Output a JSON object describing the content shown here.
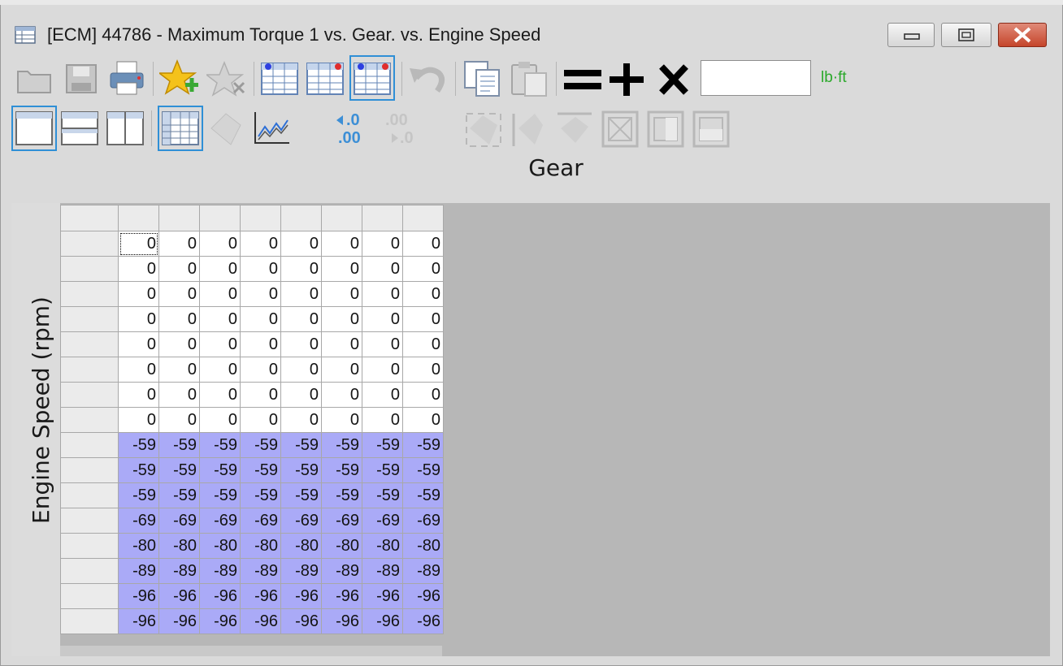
{
  "window": {
    "title": "[ECM] 44786 - Maximum Torque 1 vs. Gear. vs. Engine Speed"
  },
  "toolbar": {
    "value_input": "",
    "unit": "lb·ft"
  },
  "axes": {
    "x_title": "Gear",
    "y_title": "Engine Speed (rpm)"
  },
  "table": {
    "column_headers": [
      "",
      "",
      "",
      "",
      "",
      "",
      "",
      ""
    ],
    "row_headers": [
      "",
      "",
      "",
      "",
      "",
      "",
      "",
      "",
      "",
      "",
      "",
      "",
      "",
      "",
      "",
      ""
    ],
    "rows": [
      [
        "0",
        "0",
        "0",
        "0",
        "0",
        "0",
        "0",
        "0"
      ],
      [
        "0",
        "0",
        "0",
        "0",
        "0",
        "0",
        "0",
        "0"
      ],
      [
        "0",
        "0",
        "0",
        "0",
        "0",
        "0",
        "0",
        "0"
      ],
      [
        "0",
        "0",
        "0",
        "0",
        "0",
        "0",
        "0",
        "0"
      ],
      [
        "0",
        "0",
        "0",
        "0",
        "0",
        "0",
        "0",
        "0"
      ],
      [
        "0",
        "0",
        "0",
        "0",
        "0",
        "0",
        "0",
        "0"
      ],
      [
        "0",
        "0",
        "0",
        "0",
        "0",
        "0",
        "0",
        "0"
      ],
      [
        "0",
        "0",
        "0",
        "0",
        "0",
        "0",
        "0",
        "0"
      ],
      [
        "-59",
        "-59",
        "-59",
        "-59",
        "-59",
        "-59",
        "-59",
        "-59"
      ],
      [
        "-59",
        "-59",
        "-59",
        "-59",
        "-59",
        "-59",
        "-59",
        "-59"
      ],
      [
        "-59",
        "-59",
        "-59",
        "-59",
        "-59",
        "-59",
        "-59",
        "-59"
      ],
      [
        "-69",
        "-69",
        "-69",
        "-69",
        "-69",
        "-69",
        "-69",
        "-69"
      ],
      [
        "-80",
        "-80",
        "-80",
        "-80",
        "-80",
        "-80",
        "-80",
        "-80"
      ],
      [
        "-89",
        "-89",
        "-89",
        "-89",
        "-89",
        "-89",
        "-89",
        "-89"
      ],
      [
        "-96",
        "-96",
        "-96",
        "-96",
        "-96",
        "-96",
        "-96",
        "-96"
      ],
      [
        "-96",
        "-96",
        "-96",
        "-96",
        "-96",
        "-96",
        "-96",
        "-96"
      ]
    ]
  },
  "colors": {
    "negative_cell": "#aaaaf7",
    "selection_border": "#2f8fd6",
    "unit_text": "#2aa82a"
  }
}
